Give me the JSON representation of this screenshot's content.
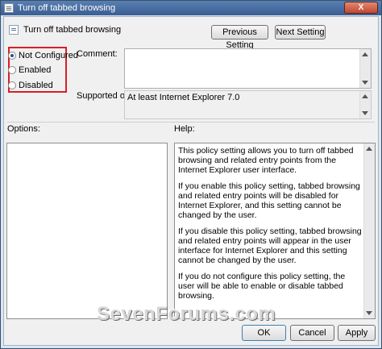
{
  "window": {
    "title": "Turn off tabbed browsing",
    "close_label": "X"
  },
  "setting": {
    "title": "Turn off tabbed browsing"
  },
  "nav": {
    "previous_label": "Previous Setting",
    "next_label": "Next Setting"
  },
  "state_options": [
    {
      "label": "Not Configured",
      "checked": true
    },
    {
      "label": "Enabled",
      "checked": false
    },
    {
      "label": "Disabled",
      "checked": false
    }
  ],
  "comment": {
    "label": "Comment:",
    "value": ""
  },
  "supported": {
    "label": "Supported on:",
    "value": "At least Internet Explorer 7.0"
  },
  "options": {
    "label": "Options:"
  },
  "help": {
    "label": "Help:",
    "paragraphs": [
      "This policy setting allows you to turn off tabbed browsing and related entry points from the Internet Explorer user interface.",
      "If you enable this policy setting, tabbed browsing and related entry points will be disabled for Internet Explorer, and this setting cannot be changed by the user.",
      "If you disable this policy setting, tabbed browsing and related entry points will appear in the user interface for Internet Explorer and this setting cannot be changed by the user.",
      "If you do not configure this policy setting, the user will be able to enable or disable tabbed browsing."
    ]
  },
  "watermark": {
    "text": "SevenForums.com"
  },
  "footer": {
    "ok_label": "OK",
    "cancel_label": "Cancel",
    "apply_label": "Apply"
  }
}
